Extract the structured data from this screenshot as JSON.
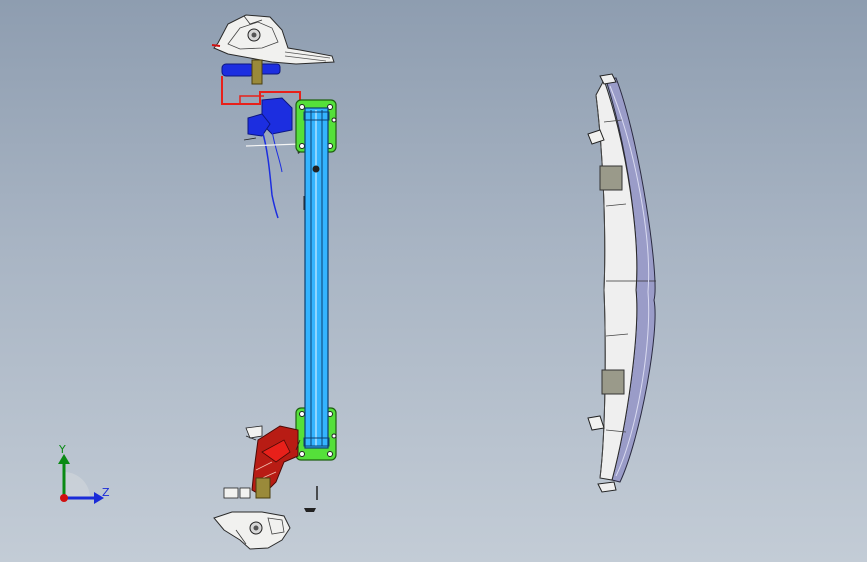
{
  "viewport": {
    "background_top": "#8e9db0",
    "background_bottom": "#c3ccd6"
  },
  "triad": {
    "y_label": "Y",
    "z_label": "Z",
    "y_color": "#0a8a14",
    "z_color": "#1a2bd8",
    "origin_color": "#d01010"
  },
  "model_colors": {
    "beam_frame": "#55e03a",
    "beam_channel": "#34b4ff",
    "wiring": "#1c2ee0",
    "harness_red": "#e8201a",
    "bracket_red": "#b81c14",
    "fascia": "#9a9cc8",
    "housing": "#f2f2f0"
  }
}
